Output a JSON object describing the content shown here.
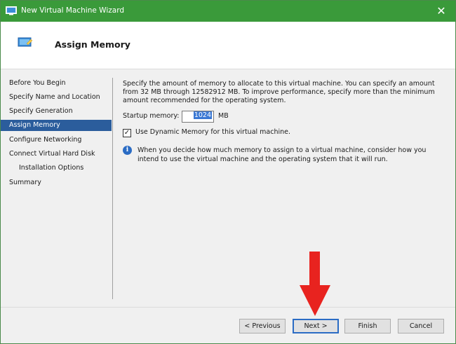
{
  "window": {
    "title": "New Virtual Machine Wizard",
    "close_glyph": "✕"
  },
  "header": {
    "title": "Assign Memory"
  },
  "nav": {
    "items": [
      {
        "label": "Before You Begin",
        "sub": false,
        "active": false
      },
      {
        "label": "Specify Name and Location",
        "sub": false,
        "active": false
      },
      {
        "label": "Specify Generation",
        "sub": false,
        "active": false
      },
      {
        "label": "Assign Memory",
        "sub": false,
        "active": true
      },
      {
        "label": "Configure Networking",
        "sub": false,
        "active": false
      },
      {
        "label": "Connect Virtual Hard Disk",
        "sub": false,
        "active": false
      },
      {
        "label": "Installation Options",
        "sub": true,
        "active": false
      },
      {
        "label": "Summary",
        "sub": false,
        "active": false
      }
    ]
  },
  "main": {
    "description": "Specify the amount of memory to allocate to this virtual machine. You can specify an amount from 32 MB through 12582912 MB. To improve performance, specify more than the minimum amount recommended for the operating system.",
    "startup_memory_label": "Startup memory:",
    "startup_memory_value": "1024",
    "startup_memory_unit": "MB",
    "dynamic_memory_label": "Use Dynamic Memory for this virtual machine.",
    "dynamic_memory_checked": true,
    "info_text": "When you decide how much memory to assign to a virtual machine, consider how you intend to use the virtual machine and the operating system that it will run."
  },
  "buttons": {
    "previous": "< Previous",
    "next": "Next >",
    "finish": "Finish",
    "cancel": "Cancel"
  },
  "colors": {
    "titlebar": "#3a9a3a",
    "nav_active": "#2b5d9c",
    "annotation_arrow": "#e8231f"
  }
}
